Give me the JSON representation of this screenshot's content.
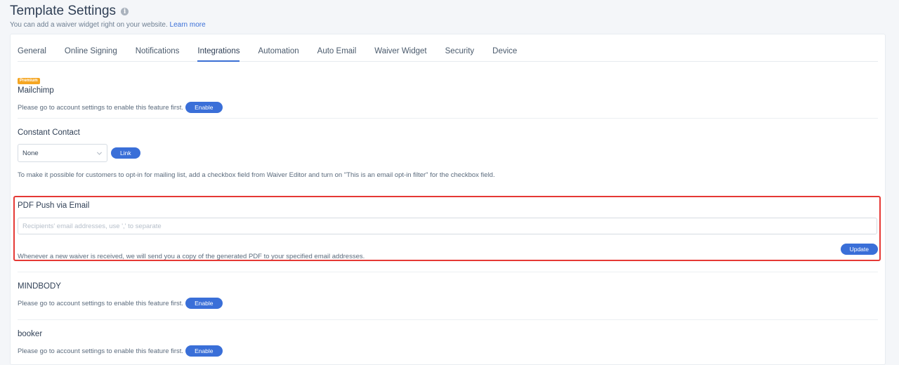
{
  "header": {
    "title": "Template Settings",
    "subtitle": "You can add a waiver widget right on your website.",
    "learn_more": "Learn more"
  },
  "tabs": [
    {
      "label": "General"
    },
    {
      "label": "Online Signing"
    },
    {
      "label": "Notifications"
    },
    {
      "label": "Integrations",
      "active": true
    },
    {
      "label": "Automation"
    },
    {
      "label": "Auto Email"
    },
    {
      "label": "Waiver Widget"
    },
    {
      "label": "Security"
    },
    {
      "label": "Device"
    }
  ],
  "mailchimp": {
    "badge": "Premium",
    "title": "Mailchimp",
    "note": "Please go to account settings to enable this feature first.",
    "button": "Enable"
  },
  "constant_contact": {
    "title": "Constant Contact",
    "select_value": "None",
    "button": "Link",
    "note": "To make it possible for customers to opt-in for mailing list, add a checkbox field from Waiver Editor and turn on \"This is an email opt-in filter\" for the checkbox field."
  },
  "pdf_push": {
    "title": "PDF Push via Email",
    "placeholder": "Recipients' email addresses, use ',' to separate",
    "value": "",
    "button": "Update",
    "note": "Whenever a new waiver is received, we will send you a copy of the generated PDF to your specified email addresses.",
    "highlight_color": "#e53935"
  },
  "mindbody": {
    "title": "MINDBODY",
    "note": "Please go to account settings to enable this feature first.",
    "button": "Enable"
  },
  "booker": {
    "title": "booker",
    "note": "Please go to account settings to enable this feature first.",
    "button": "Enable"
  },
  "colors": {
    "accent": "#3a6fd8",
    "premium": "#f5a623"
  }
}
